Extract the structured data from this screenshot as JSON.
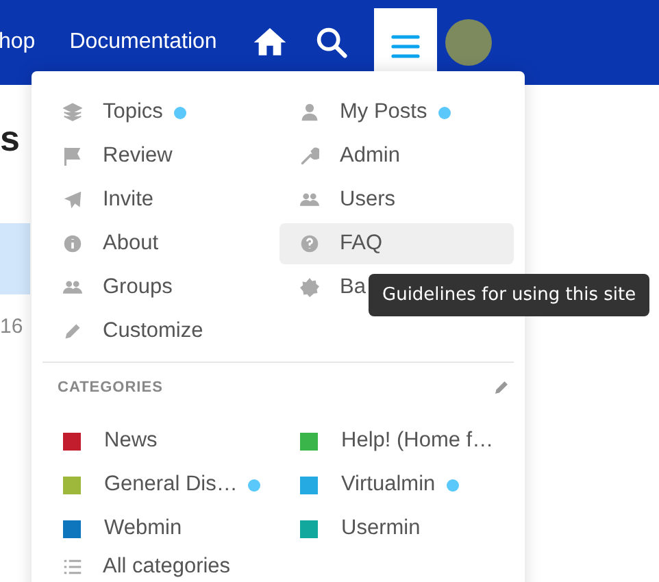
{
  "header": {
    "nav_links": [
      "hop",
      "Documentation"
    ],
    "menu_button": {
      "expanded": true
    }
  },
  "background": {
    "heading_fragment": "s",
    "count_fragment": "16"
  },
  "menu": {
    "items": [
      {
        "label": "Topics",
        "unread": true,
        "hovered": false
      },
      {
        "label": "My Posts",
        "unread": true,
        "hovered": false
      },
      {
        "label": "Review",
        "unread": false,
        "hovered": false
      },
      {
        "label": "Admin",
        "unread": false,
        "hovered": false
      },
      {
        "label": "Invite",
        "unread": false,
        "hovered": false
      },
      {
        "label": "Users",
        "unread": false,
        "hovered": false
      },
      {
        "label": "About",
        "unread": false,
        "hovered": false
      },
      {
        "label": "FAQ",
        "unread": false,
        "hovered": true
      },
      {
        "label": "Groups",
        "unread": false,
        "hovered": false
      },
      {
        "label": "Ba",
        "unread": false,
        "hovered": false
      },
      {
        "label": "Customize",
        "unread": false,
        "hovered": false
      }
    ],
    "categories_heading": "CATEGORIES",
    "categories": [
      {
        "name": "News",
        "color": "#c21d2d",
        "unread": false
      },
      {
        "name": "Help! (Home f…",
        "color": "#3ab54a",
        "unread": false
      },
      {
        "name": "General Dis…",
        "color": "#9eb83b",
        "unread": true
      },
      {
        "name": "Virtualmin",
        "color": "#25aae1",
        "unread": true
      },
      {
        "name": "Webmin",
        "color": "#0e76bd",
        "unread": false
      },
      {
        "name": "Usermin",
        "color": "#12a89d",
        "unread": false
      }
    ],
    "all_categories": "All categories"
  },
  "tooltip": "Guidelines for using this site"
}
